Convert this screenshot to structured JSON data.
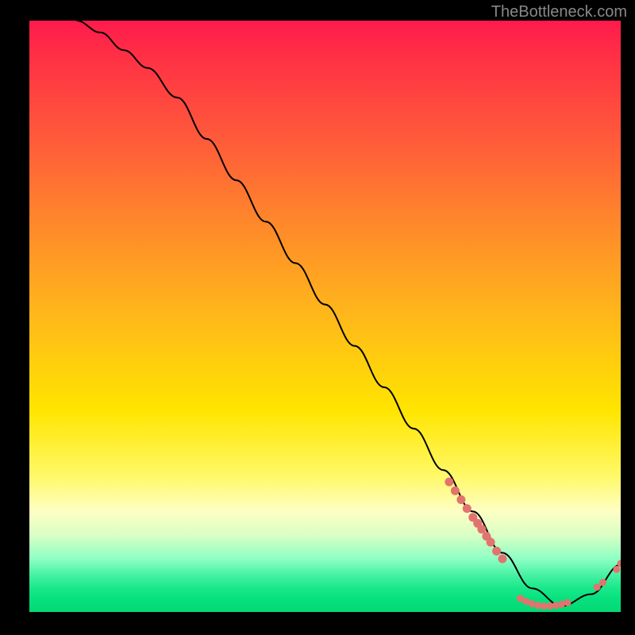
{
  "watermark": "TheBottleneck.com",
  "chart_data": {
    "type": "line",
    "title": "",
    "xlabel": "",
    "ylabel": "",
    "xlim": [
      0,
      100
    ],
    "ylim": [
      0,
      100
    ],
    "series": [
      {
        "name": "curve",
        "x": [
          8,
          12,
          16,
          20,
          25,
          30,
          35,
          40,
          45,
          50,
          55,
          60,
          65,
          70,
          75,
          80,
          85,
          90,
          95,
          100
        ],
        "y": [
          100,
          98,
          95,
          92,
          87,
          80,
          73,
          66,
          59,
          52,
          45,
          38,
          31,
          24,
          17,
          10,
          4,
          1,
          3,
          8
        ]
      }
    ],
    "markers_cluster_a": {
      "comment": "pink dots along descending segment near bottom",
      "points": [
        {
          "x": 71,
          "y": 22
        },
        {
          "x": 72,
          "y": 20.5
        },
        {
          "x": 73,
          "y": 19
        },
        {
          "x": 74,
          "y": 17.5
        },
        {
          "x": 75,
          "y": 16
        },
        {
          "x": 75.8,
          "y": 15
        },
        {
          "x": 76.5,
          "y": 14
        },
        {
          "x": 77.3,
          "y": 12.8
        },
        {
          "x": 78,
          "y": 11.8
        },
        {
          "x": 79,
          "y": 10.3
        },
        {
          "x": 80,
          "y": 9
        }
      ]
    },
    "markers_cluster_b": {
      "comment": "pink dots along flat bottom",
      "points": [
        {
          "x": 83,
          "y": 2.3
        },
        {
          "x": 84,
          "y": 1.8
        },
        {
          "x": 85,
          "y": 1.4
        },
        {
          "x": 86,
          "y": 1.1
        },
        {
          "x": 87,
          "y": 1.0
        },
        {
          "x": 88,
          "y": 1.0
        },
        {
          "x": 89,
          "y": 1.1
        },
        {
          "x": 90,
          "y": 1.3
        },
        {
          "x": 91,
          "y": 1.6
        }
      ]
    },
    "markers_cluster_c": {
      "comment": "pink dots on rising tail",
      "points": [
        {
          "x": 96,
          "y": 4.2
        },
        {
          "x": 97,
          "y": 5.0
        },
        {
          "x": 99.3,
          "y": 7.2
        },
        {
          "x": 100,
          "y": 8.2
        }
      ]
    },
    "marker_color": "#e2736e",
    "curve_color": "#000000"
  }
}
